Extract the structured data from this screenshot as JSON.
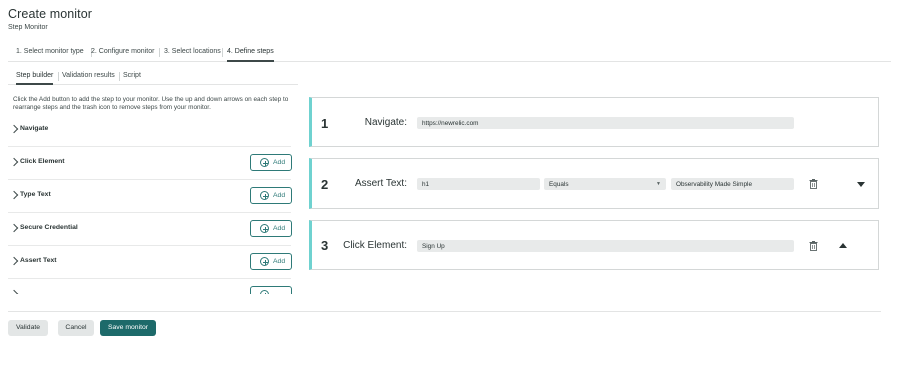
{
  "header": {
    "title": "Create monitor",
    "subtitle": "Step Monitor"
  },
  "wizard": {
    "steps": [
      "1. Select monitor type",
      "2. Configure monitor",
      "3. Select locations",
      "4. Define steps"
    ],
    "active": "4. Define steps"
  },
  "subtabs": {
    "tabs": [
      "Step builder",
      "Validation results",
      "Script"
    ],
    "active": "Step builder"
  },
  "instructions": "Click the Add button to add the step to your monitor. Use the up and down arrows on each step to rearrange steps and the trash icon to remove steps from your monitor.",
  "step_list": {
    "add_label": "Add",
    "items": [
      "Navigate",
      "Click Element",
      "Type Text",
      "Secure Credential",
      "Assert Text"
    ]
  },
  "steps": [
    {
      "number": "1",
      "label": "Navigate:",
      "fields": [
        "https://newrelic.com"
      ]
    },
    {
      "number": "2",
      "label": "Assert Text:",
      "fields": [
        "h1",
        "Equals",
        "Observability Made Simple"
      ]
    },
    {
      "number": "3",
      "label": "Click Element:",
      "fields": [
        "Sign Up"
      ]
    }
  ],
  "footer": {
    "validate": "Validate",
    "cancel": "Cancel",
    "save": "Save monitor"
  },
  "colors": {
    "accent": "#6fd2d0",
    "primary_button": "#1d6a6a",
    "add_outline": "#2e7a78"
  }
}
